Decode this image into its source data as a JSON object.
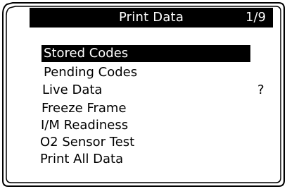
{
  "header": {
    "title": "Print Data",
    "page_indicator": "1/9"
  },
  "menu": {
    "items": [
      {
        "label": "Stored Codes",
        "selected": true
      },
      {
        "label": "Pending Codes",
        "selected": false
      },
      {
        "label": "Live Data",
        "selected": false
      },
      {
        "label": "Freeze Frame",
        "selected": false
      },
      {
        "label": "I/M Readiness",
        "selected": false
      },
      {
        "label": "O2 Sensor Test",
        "selected": false
      },
      {
        "label": "Print All Data",
        "selected": false
      }
    ],
    "live_data_status": "?"
  },
  "colors": {
    "highlight": "#000000",
    "highlight_text": "#ffffff",
    "text": "#000000",
    "background": "#ffffff"
  }
}
